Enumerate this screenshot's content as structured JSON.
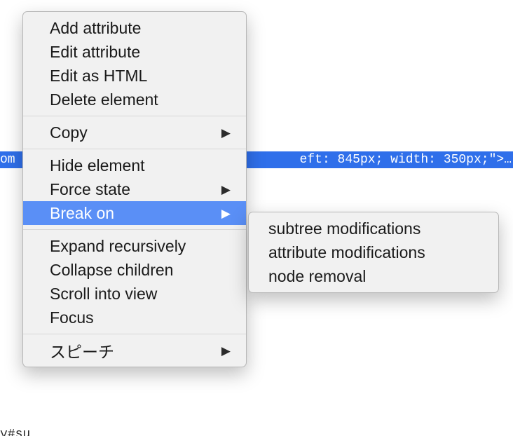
{
  "code_strip": {
    "left_fragment": "om",
    "right_fragment": "eft: 845px; width: 350px;\">…"
  },
  "bottom_fragment": "y#su…",
  "menu": {
    "group1": {
      "add_attribute": "Add attribute",
      "edit_attribute": "Edit attribute",
      "edit_as_html": "Edit as HTML",
      "delete_element": "Delete element"
    },
    "group2": {
      "copy": "Copy"
    },
    "group3": {
      "hide_element": "Hide element",
      "force_state": "Force state",
      "break_on": "Break on"
    },
    "group4": {
      "expand_recursively": "Expand recursively",
      "collapse_children": "Collapse children",
      "scroll_into_view": "Scroll into view",
      "focus": "Focus"
    },
    "group5": {
      "speech": "スピーチ"
    }
  },
  "submenu": {
    "subtree_modifications": "subtree modifications",
    "attribute_modifications": "attribute modifications",
    "node_removal": "node removal"
  }
}
